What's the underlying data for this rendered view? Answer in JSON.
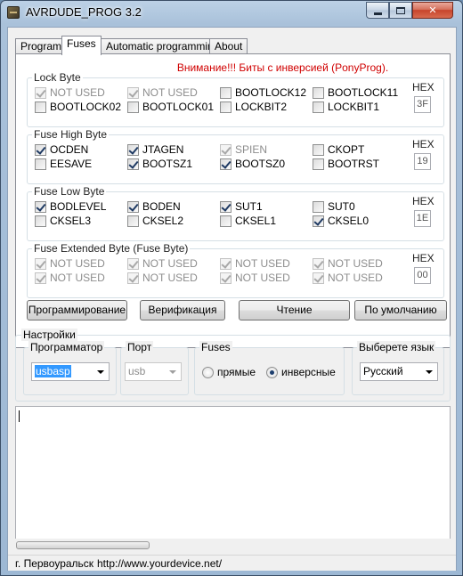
{
  "window": {
    "title": "AVRDUDE_PROG 3.2"
  },
  "tabs": [
    {
      "label": "Program",
      "active": false
    },
    {
      "label": "Fuses",
      "active": true
    },
    {
      "label": "Automatic programming",
      "active": false
    },
    {
      "label": "About",
      "active": false
    }
  ],
  "warning": "Внимание!!! Биты с инверсией (PonyProg).",
  "groups": {
    "lock": {
      "title": "Lock Byte",
      "hex_label": "HEX",
      "hex": "3F",
      "bits": [
        {
          "label": "NOT USED",
          "checked": true,
          "enabled": false
        },
        {
          "label": "NOT USED",
          "checked": true,
          "enabled": false
        },
        {
          "label": "BOOTLOCK12",
          "checked": false,
          "enabled": true
        },
        {
          "label": "BOOTLOCK11",
          "checked": false,
          "enabled": true
        },
        {
          "label": "BOOTLOCK02",
          "checked": false,
          "enabled": true
        },
        {
          "label": "BOOTLOCK01",
          "checked": false,
          "enabled": true
        },
        {
          "label": "LOCKBIT2",
          "checked": false,
          "enabled": true
        },
        {
          "label": "LOCKBIT1",
          "checked": false,
          "enabled": true
        }
      ]
    },
    "high": {
      "title": "Fuse High Byte",
      "hex_label": "HEX",
      "hex": "19",
      "bits": [
        {
          "label": "OCDEN",
          "checked": true,
          "enabled": true
        },
        {
          "label": "JTAGEN",
          "checked": true,
          "enabled": true
        },
        {
          "label": "SPIEN",
          "checked": true,
          "enabled": false
        },
        {
          "label": "CKOPT",
          "checked": false,
          "enabled": true
        },
        {
          "label": "EESAVE",
          "checked": false,
          "enabled": true
        },
        {
          "label": "BOOTSZ1",
          "checked": true,
          "enabled": true
        },
        {
          "label": "BOOTSZ0",
          "checked": true,
          "enabled": true
        },
        {
          "label": "BOOTRST",
          "checked": false,
          "enabled": true
        }
      ]
    },
    "low": {
      "title": "Fuse Low Byte",
      "hex_label": "HEX",
      "hex": "1E",
      "bits": [
        {
          "label": "BODLEVEL",
          "checked": true,
          "enabled": true
        },
        {
          "label": "BODEN",
          "checked": true,
          "enabled": true
        },
        {
          "label": "SUT1",
          "checked": true,
          "enabled": true
        },
        {
          "label": "SUT0",
          "checked": false,
          "enabled": true
        },
        {
          "label": "CKSEL3",
          "checked": false,
          "enabled": true
        },
        {
          "label": "CKSEL2",
          "checked": false,
          "enabled": true
        },
        {
          "label": "CKSEL1",
          "checked": false,
          "enabled": true
        },
        {
          "label": "CKSEL0",
          "checked": true,
          "enabled": true
        }
      ]
    },
    "ext": {
      "title": "Fuse Extended Byte (Fuse Byte)",
      "hex_label": "HEX",
      "hex": "00",
      "bits": [
        {
          "label": "NOT USED",
          "checked": true,
          "enabled": false
        },
        {
          "label": "NOT USED",
          "checked": true,
          "enabled": false
        },
        {
          "label": "NOT USED",
          "checked": true,
          "enabled": false
        },
        {
          "label": "NOT USED",
          "checked": true,
          "enabled": false
        },
        {
          "label": "NOT USED",
          "checked": true,
          "enabled": false
        },
        {
          "label": "NOT USED",
          "checked": true,
          "enabled": false
        },
        {
          "label": "NOT USED",
          "checked": true,
          "enabled": false
        },
        {
          "label": "NOT USED",
          "checked": true,
          "enabled": false
        }
      ]
    }
  },
  "buttons": {
    "program": "Программирование",
    "verify": "Верификация",
    "read": "Чтение",
    "default": "По умолчанию"
  },
  "settings": {
    "title": "Настройки",
    "programmer": {
      "label": "Программатор",
      "value": "usbasp"
    },
    "port": {
      "label": "Порт",
      "value": "usb"
    },
    "fuses": {
      "label": "Fuses",
      "direct": "прямые",
      "inverse": "инверсные",
      "selected": "inverse"
    },
    "language": {
      "label": "Выберете язык",
      "value": "Русский"
    }
  },
  "status": {
    "city": "г. Первоуральск",
    "url": "http://www.yourdevice.net/"
  },
  "icons": [
    "app-icon",
    "minimize-icon",
    "maximize-icon",
    "close-icon",
    "dropdown-arrow-icon"
  ]
}
